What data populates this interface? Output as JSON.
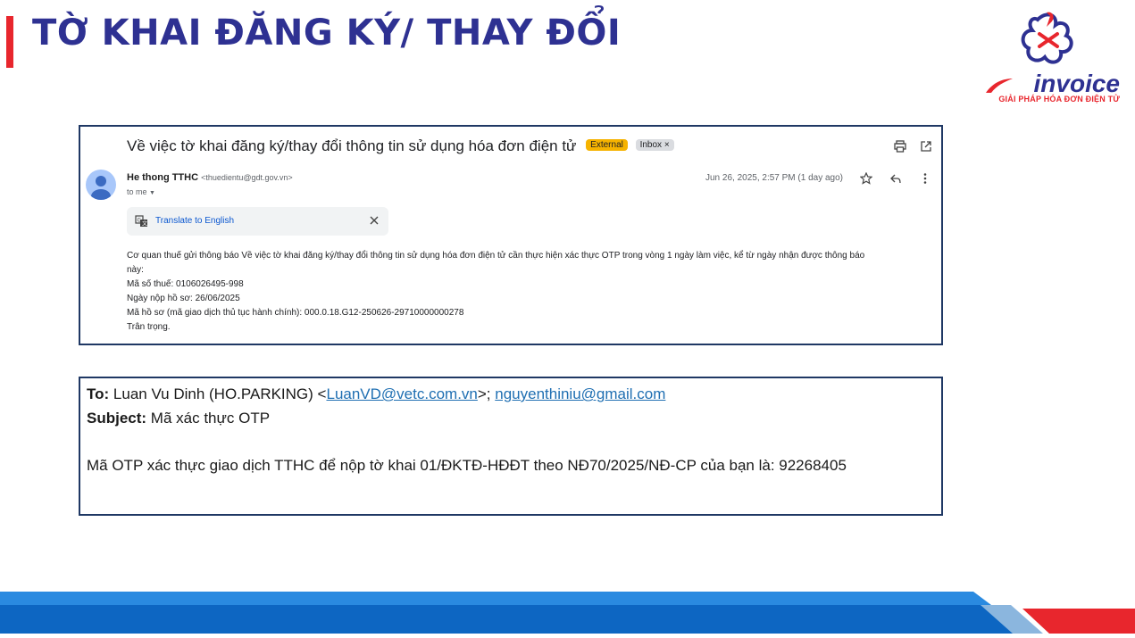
{
  "slide": {
    "title": "TỜ KHAI ĐĂNG KÝ/ THAY ĐỔI"
  },
  "logo": {
    "word": "invoice",
    "tagline": "GIẢI PHÁP HÓA ĐƠN ĐIỆN TỬ"
  },
  "email": {
    "subject": "Về việc tờ khai đăng ký/thay đổi thông tin sử dụng hóa đơn điện tử",
    "badge_external": "External",
    "badge_inbox": "Inbox",
    "badge_inbox_close": "×",
    "sender_name": "He thong TTHC",
    "sender_email": "<thuedientu@gdt.gov.vn>",
    "to_me": "to me",
    "date": "Jun 26, 2025, 2:57 PM (1 day ago)",
    "translate_label": "Translate to English",
    "body": [
      "Cơ quan thuế gửi thông báo Về việc tờ khai đăng ký/thay đổi thông tin sử dụng hóa đơn điện tử cần thực hiện xác thực OTP trong vòng 1 ngày làm việc, kể từ ngày nhận được thông báo",
      "này:",
      "Mã số thuế: 0106026495-998",
      "Ngày nộp hồ sơ: 26/06/2025",
      "Mã hồ sơ (mã giao dịch thủ tục hành chính): 000.0.18.G12-250626-29710000000278",
      "Trân trọng."
    ]
  },
  "otp_email": {
    "to_label": "To:",
    "to_name": "Luan Vu Dinh (HO.PARKING) <",
    "to_link1": "LuanVD@vetc.com.vn",
    "to_sep": ">; ",
    "to_link2": "nguyenthiniu@gmail.com",
    "subject_label": "Subject:",
    "subject_value": "Mã xác thực OTP",
    "message": "Mã OTP xác thực giao dịch TTHC để nộp tờ khai 01/ĐKTĐ-HĐĐT theo NĐ70/2025/NĐ-CP của bạn là: 92268405"
  },
  "colors": {
    "title": "#2e3192",
    "accent_red": "#e8262d",
    "frame": "#1f3864",
    "footer_blue": "#0d66c2",
    "footer_light": "#5b9bd5"
  }
}
